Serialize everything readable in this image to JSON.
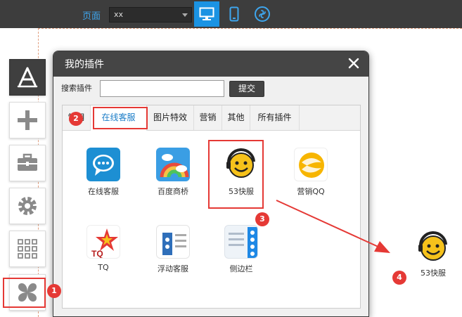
{
  "topbar": {
    "page_label": "页面",
    "page_select": "xx",
    "device_buttons": [
      "desktop-icon",
      "mobile-icon",
      "miniprogram-icon"
    ],
    "accent_color": "#1b93e3"
  },
  "sidebar": {
    "items": [
      "appstore-icon",
      "plus-icon",
      "toolbox-icon",
      "gear-icon",
      "grid-icon",
      "plugin-icon"
    ]
  },
  "panel": {
    "title": "我的插件",
    "search_label": "搜索插件",
    "search_value": "",
    "search_button": "提交",
    "tabs": [
      "常用",
      "在线客服",
      "图片特效",
      "营销",
      "其他",
      "所有插件"
    ],
    "active_tab": "在线客服",
    "plugins": [
      {
        "name": "在线客服",
        "icon": "chat-bubble-icon"
      },
      {
        "name": "百度商桥",
        "icon": "rainbow-icon"
      },
      {
        "name": "53快服",
        "icon": "smiley-headset-icon"
      },
      {
        "name": "营销QQ",
        "icon": "marketing-qq-icon"
      },
      {
        "name": "TQ",
        "icon": "tq-star-icon"
      },
      {
        "name": "浮动客服",
        "icon": "float-service-icon"
      },
      {
        "name": "侧边栏",
        "icon": "sidebar-icon"
      }
    ]
  },
  "annotations": {
    "badges": [
      "1",
      "2",
      "3",
      "4"
    ],
    "highlight_color": "#e53935",
    "dropped_plugin_label": "53快服"
  }
}
